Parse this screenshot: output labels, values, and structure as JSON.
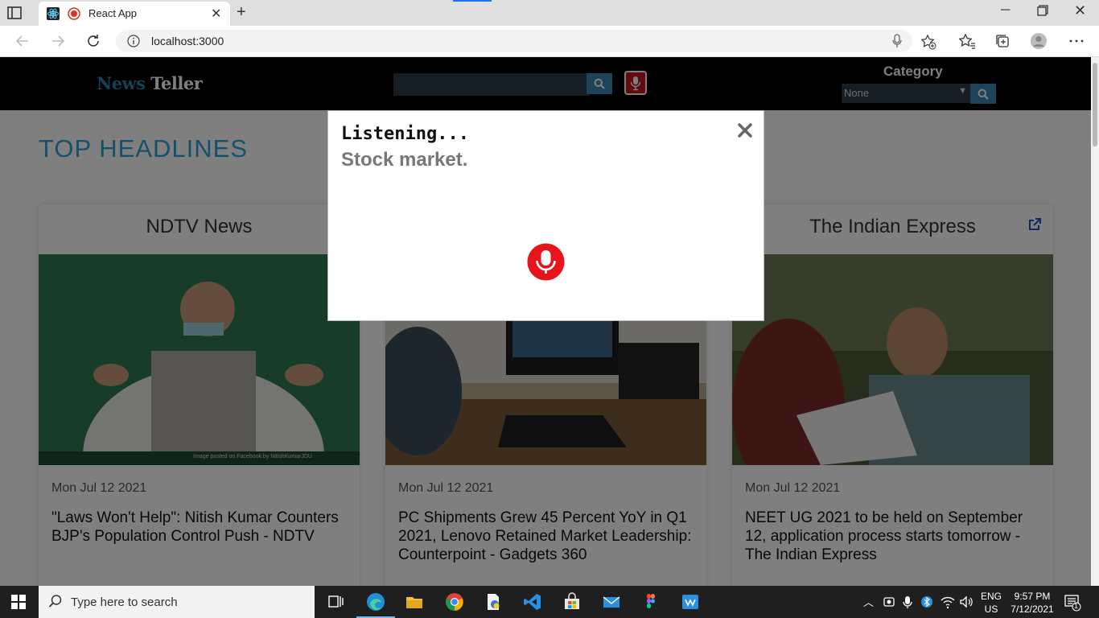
{
  "browser": {
    "tab_title": "React App",
    "url": "localhost:3000"
  },
  "site": {
    "logo_part1": "News",
    "logo_part2": " Teller",
    "search_placeholder": "",
    "category_label": "Category",
    "category_selected": "None",
    "section_title": "TOP HEADLINES"
  },
  "cards": [
    {
      "source": "NDTV News",
      "date": "Mon Jul 12 2021",
      "headline": "\"Laws Won't Help\": Nitish Kumar Counters BJP's Population Control Push - NDTV",
      "image_caption": "Image posted on Facebook by NitishKumarJDU"
    },
    {
      "source": "",
      "date": "Mon Jul 12 2021",
      "headline": "PC Shipments Grew 45 Percent YoY in Q1 2021, Lenovo Retained Market Leadership: Counterpoint - Gadgets 360"
    },
    {
      "source": "The Indian Express",
      "date": "Mon Jul 12 2021",
      "headline": "NEET UG 2021 to be held on September 12, application process starts tomorrow - The Indian Express"
    }
  ],
  "modal": {
    "status": "Listening...",
    "transcript": "Stock market."
  },
  "taskbar": {
    "search_placeholder": "Type here to search",
    "lang_line1": "ENG",
    "lang_line2": "US",
    "time": "9:57 PM",
    "date": "7/12/2021",
    "notification_count": "1"
  },
  "colors": {
    "accent": "#2aa0d8",
    "mic_red": "#e8141b",
    "header_bg": "#000000"
  }
}
